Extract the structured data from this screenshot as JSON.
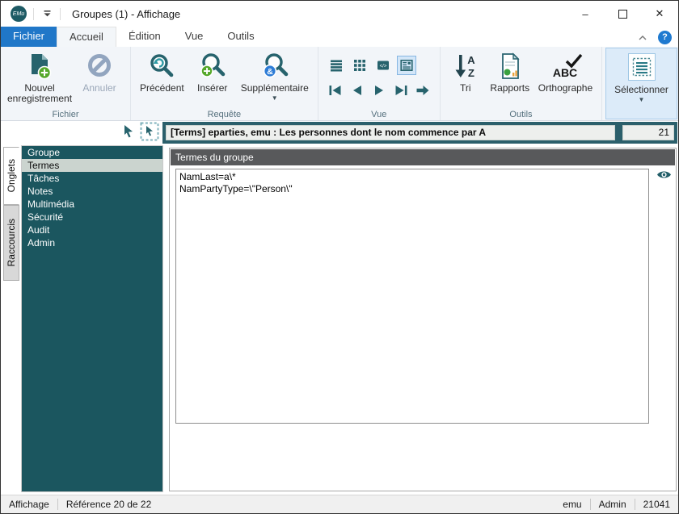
{
  "window": {
    "title": "Groupes (1) - Affichage",
    "logo": "EMu"
  },
  "tabs": {
    "file": "Fichier",
    "items": [
      "Accueil",
      "Édition",
      "Vue",
      "Outils"
    ],
    "help": "?"
  },
  "ribbon": {
    "file_group": {
      "label": "Fichier",
      "new_record": "Nouvel enregistrement",
      "cancel": "Annuler"
    },
    "query_group": {
      "label": "Requête",
      "previous": "Précédent",
      "insert": "Insérer",
      "additional": "Supplémentaire"
    },
    "view_group": {
      "label": "Vue"
    },
    "tools_group": {
      "label": "Outils",
      "sort": "Tri",
      "reports": "Rapports",
      "spelling": "Orthographe"
    },
    "select_button": "Sélectionner"
  },
  "group_bar": {
    "title": "[Terms] eparties, emu : Les personnes dont le nom commence par A",
    "count": "21"
  },
  "sidebar": {
    "tabs": [
      {
        "label": "Onglets",
        "active": true
      },
      {
        "label": "Raccourcis",
        "active": false
      }
    ],
    "items": [
      {
        "label": "Groupe",
        "selected": false
      },
      {
        "label": "Termes",
        "selected": true
      },
      {
        "label": "Tâches",
        "selected": false
      },
      {
        "label": "Notes",
        "selected": false
      },
      {
        "label": "Multimédia",
        "selected": false
      },
      {
        "label": "Sécurité",
        "selected": false
      },
      {
        "label": "Audit",
        "selected": false
      },
      {
        "label": "Admin",
        "selected": false
      }
    ]
  },
  "main": {
    "header": "Termes du groupe",
    "terms_text": "NamLast=a\\*\nNamPartyType=\\\"Person\\\""
  },
  "statusbar": {
    "mode": "Affichage",
    "reference": "Référence 20 de 22",
    "service": "emu",
    "user": "Admin",
    "number": "21041"
  },
  "colors": {
    "teal_dark": "#1b565f",
    "teal_frame": "#2b5f6b",
    "icon_teal": "#27636d",
    "accent_blue": "#2077c8",
    "selection_bg": "#cbd4cf",
    "highlight_blue": "#dcebf9"
  }
}
